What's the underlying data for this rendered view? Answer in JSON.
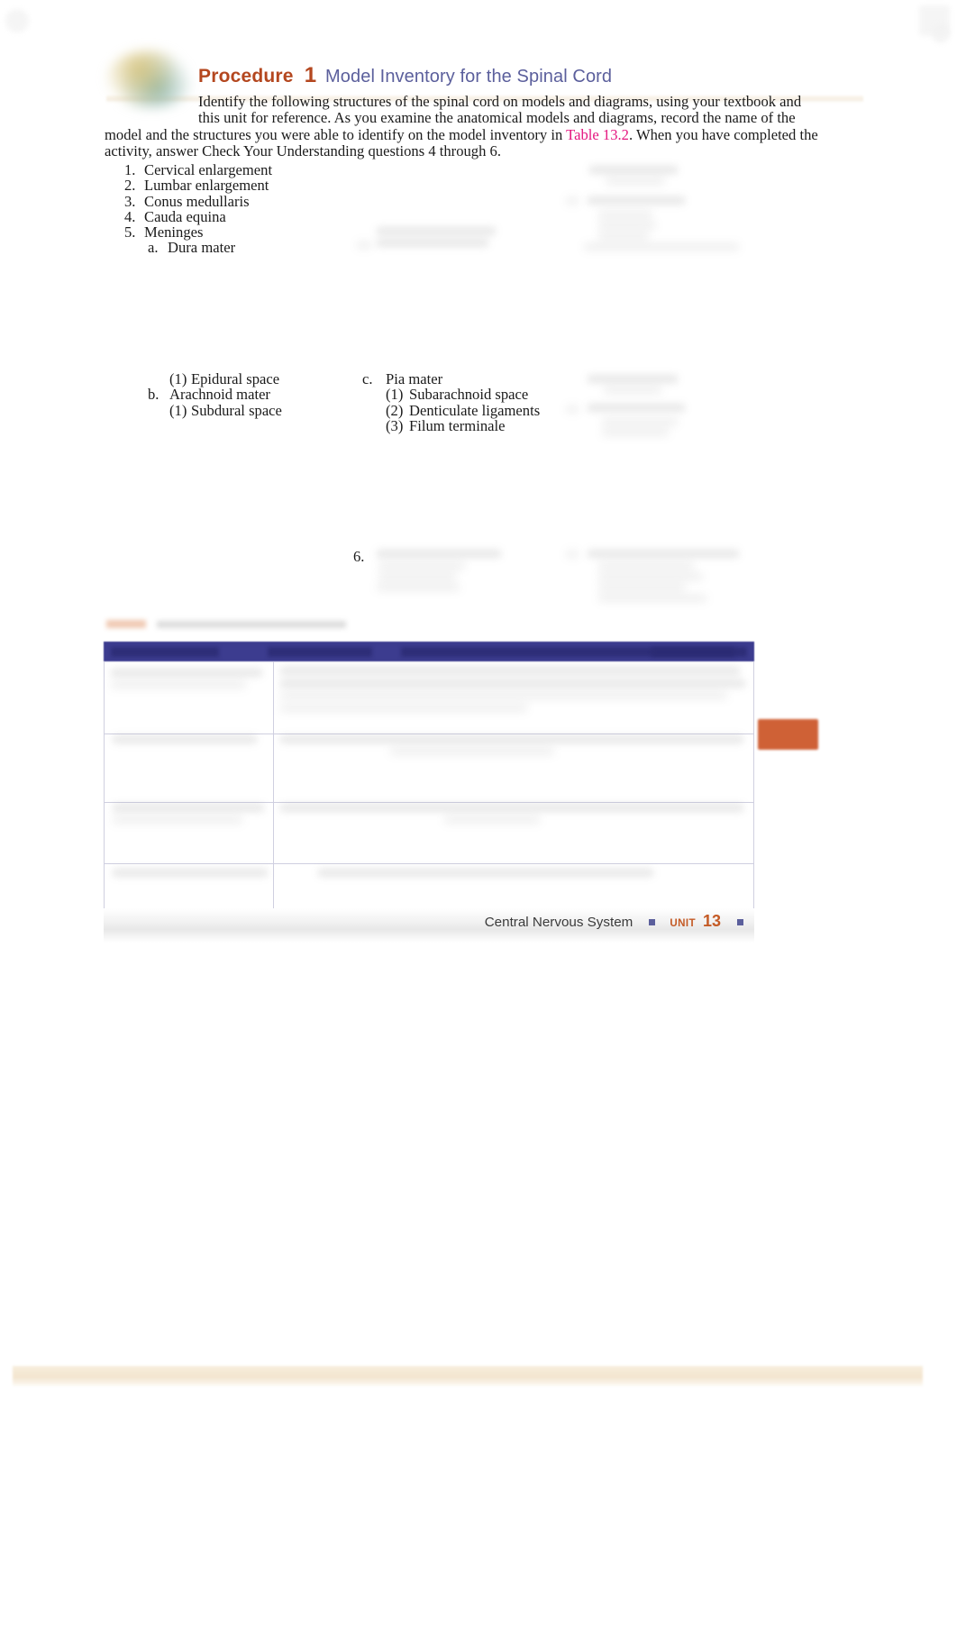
{
  "page": {
    "procedure": {
      "word": "Procedure",
      "number": "1",
      "subtitle": "Model Inventory for the Spinal Cord"
    },
    "intro_lines": [
      "Identify the following structures of the spinal cord on models and diagrams, using your textbook and",
      "this unit for reference. As you examine the anatomical models and diagrams, record the name of the",
      "model and the structures you were able to identify on the model inventory in ",
      "activity, answer Check Your Understanding questions 4 through 6."
    ],
    "intro_table_ref": "Table 13.2",
    "intro_line3_tail": ". When you have completed the",
    "main_list": [
      {
        "marker": "1.",
        "label": "Cervical enlargement"
      },
      {
        "marker": "2.",
        "label": "Lumbar enlargement"
      },
      {
        "marker": "3.",
        "label": "Conus medullaris"
      },
      {
        "marker": "4.",
        "label": "Cauda equina"
      },
      {
        "marker": "5.",
        "label": "Meninges"
      }
    ],
    "main_list_sub": [
      {
        "marker": "a.",
        "label": "Dura mater"
      }
    ],
    "left_sublist": [
      {
        "marker": "(1)",
        "label": "Epidural space",
        "indent": true
      },
      {
        "marker": "b.",
        "label": "Arachnoid mater",
        "indent": false
      },
      {
        "marker": "(1)",
        "label": "Subdural space",
        "indent": true
      }
    ],
    "mid_sublist": [
      {
        "marker": "c.",
        "label": "Pia mater",
        "indent": false
      },
      {
        "marker": "(1)",
        "label": "Subarachnoid space",
        "indent": true
      },
      {
        "marker": "(2)",
        "label": "Denticulate ligaments",
        "indent": true
      },
      {
        "marker": "(3)",
        "label": "Filum terminale",
        "indent": true
      }
    ],
    "question_marker": "6.",
    "footer": {
      "title": "Central Nervous System",
      "unit_word": "UNIT",
      "unit_number": "13"
    },
    "colors": {
      "procedure_accent": "#b4471f",
      "procedure_subtitle": "#5b5f9c",
      "table_reference": "#e4157f",
      "table_header_band": "#3c3c8f",
      "footer_unit": "#c45a25",
      "footer_square": "#5b5f9c",
      "side_tab": "#cb5426"
    },
    "redacted_note": "blurred"
  }
}
